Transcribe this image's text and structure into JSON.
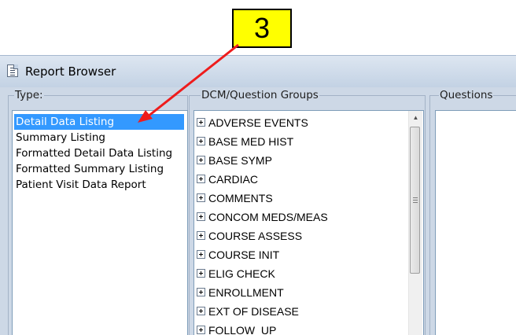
{
  "window": {
    "title": "Report Browser",
    "icon": "report-icon"
  },
  "callout": {
    "label": "3",
    "color": "#ffff00",
    "arrow_color": "#ee1c1c"
  },
  "type_group": {
    "label": "Type:",
    "items": [
      {
        "label": "Detail Data Listing",
        "selected": true
      },
      {
        "label": "Summary Listing",
        "selected": false
      },
      {
        "label": "Formatted Detail Data Listing",
        "selected": false
      },
      {
        "label": "Formatted Summary Listing",
        "selected": false
      },
      {
        "label": "Patient Visit Data Report",
        "selected": false
      }
    ]
  },
  "dcm_group": {
    "label": "DCM/Question Groups",
    "items": [
      "ADVERSE EVENTS",
      "BASE MED HIST",
      "BASE SYMP",
      "CARDIAC",
      "COMMENTS",
      "CONCOM MEDS/MEAS",
      "COURSE ASSESS",
      "COURSE INIT",
      "ELIG CHECK",
      "ENROLLMENT",
      "EXT OF DISEASE",
      "FOLLOW_UP"
    ]
  },
  "questions_group": {
    "label": "Questions"
  },
  "colors": {
    "selection": "#3399ff",
    "window_bg": "#cdd8e6"
  }
}
